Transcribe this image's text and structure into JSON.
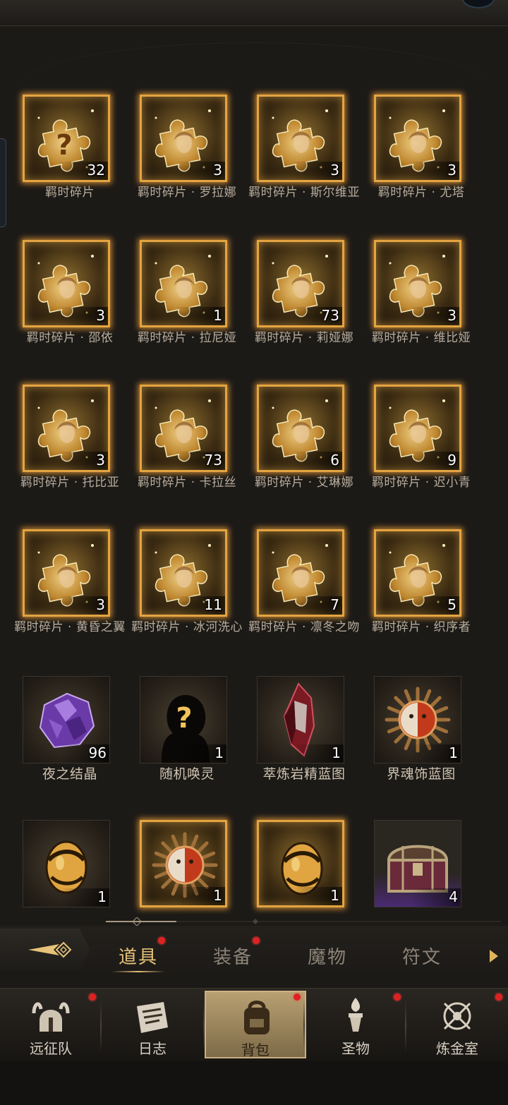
{
  "grid_items": [
    {
      "name": "羁时碎片",
      "count": "32",
      "style": "gold",
      "icon": "puzzle-question-icon"
    },
    {
      "name": "羁时碎片 · 罗拉娜",
      "count": "3",
      "style": "gold",
      "icon": "puzzle-portrait-icon"
    },
    {
      "name": "羁时碎片 · 斯尔维亚",
      "count": "3",
      "style": "gold",
      "icon": "puzzle-portrait-icon"
    },
    {
      "name": "羁时碎片 · 尤塔",
      "count": "3",
      "style": "gold",
      "icon": "puzzle-portrait-icon"
    },
    {
      "name": "羁时碎片 · 邵依",
      "count": "3",
      "style": "gold",
      "icon": "puzzle-portrait-icon"
    },
    {
      "name": "羁时碎片 · 拉尼娅",
      "count": "1",
      "style": "gold",
      "icon": "puzzle-portrait-icon"
    },
    {
      "name": "羁时碎片 · 莉娅娜",
      "count": "73",
      "style": "gold",
      "icon": "puzzle-portrait-icon"
    },
    {
      "name": "羁时碎片 · 维比娅",
      "count": "3",
      "style": "gold",
      "icon": "puzzle-portrait-icon"
    },
    {
      "name": "羁时碎片 · 托比亚",
      "count": "3",
      "style": "gold",
      "icon": "puzzle-portrait-icon"
    },
    {
      "name": "羁时碎片 · 卡拉丝",
      "count": "73",
      "style": "gold",
      "icon": "puzzle-portrait-icon"
    },
    {
      "name": "羁时碎片 · 艾琳娜",
      "count": "6",
      "style": "gold",
      "icon": "puzzle-portrait-icon"
    },
    {
      "name": "羁时碎片 · 迟小青",
      "count": "9",
      "style": "gold",
      "icon": "puzzle-portrait-icon"
    },
    {
      "name": "羁时碎片 · 黄昏之翼",
      "count": "3",
      "style": "gold",
      "icon": "puzzle-portrait-icon"
    },
    {
      "name": "羁时碎片 · 冰河洗心",
      "count": "11",
      "style": "gold",
      "icon": "puzzle-portrait-icon"
    },
    {
      "name": "羁时碎片 · 凛冬之吻",
      "count": "7",
      "style": "gold",
      "icon": "puzzle-portrait-icon"
    },
    {
      "name": "羁时碎片 · 织序者",
      "count": "5",
      "style": "gold",
      "icon": "puzzle-portrait-icon"
    },
    {
      "name": "夜之结晶",
      "count": "96",
      "style": "plain",
      "icon": "purple-crystal-icon"
    },
    {
      "name": "随机唤灵",
      "count": "1",
      "style": "plain",
      "icon": "mystery-silhouette-icon"
    },
    {
      "name": "萃炼岩精蓝图",
      "count": "1",
      "style": "plain",
      "icon": "red-crystal-icon"
    },
    {
      "name": "界魂饰蓝图",
      "count": "1",
      "style": "plain",
      "icon": "sun-mask-icon"
    },
    {
      "name": "",
      "count": "1",
      "style": "plain",
      "icon": "golden-egg-icon"
    },
    {
      "name": "",
      "count": "1",
      "style": "gold",
      "icon": "sun-mask-icon"
    },
    {
      "name": "",
      "count": "1",
      "style": "gold",
      "icon": "golden-egg-icon"
    },
    {
      "name": "",
      "count": "4",
      "style": "purple",
      "icon": "treasure-chest-icon"
    }
  ],
  "category_tabs": [
    {
      "label": "道具",
      "active": true,
      "dot": true
    },
    {
      "label": "装备",
      "active": false,
      "dot": true
    },
    {
      "label": "魔物",
      "active": false,
      "dot": false
    },
    {
      "label": "符文",
      "active": false,
      "dot": false
    }
  ],
  "bottom_nav": [
    {
      "label": "远征队",
      "icon": "viking-helmet-icon",
      "dot": true,
      "active": false
    },
    {
      "label": "日志",
      "icon": "scroll-icon",
      "dot": false,
      "active": false
    },
    {
      "label": "背包",
      "icon": "backpack-icon",
      "dot": true,
      "active": true
    },
    {
      "label": "圣物",
      "icon": "torch-relic-icon",
      "dot": true,
      "active": false
    },
    {
      "label": "炼金室",
      "icon": "alchemy-icon",
      "dot": true,
      "active": false
    }
  ],
  "colors": {
    "gold_frame": "#e3a441",
    "active_tab": "#e6c27a",
    "notification_dot": "#dd2222",
    "background": "#1c1a17"
  }
}
